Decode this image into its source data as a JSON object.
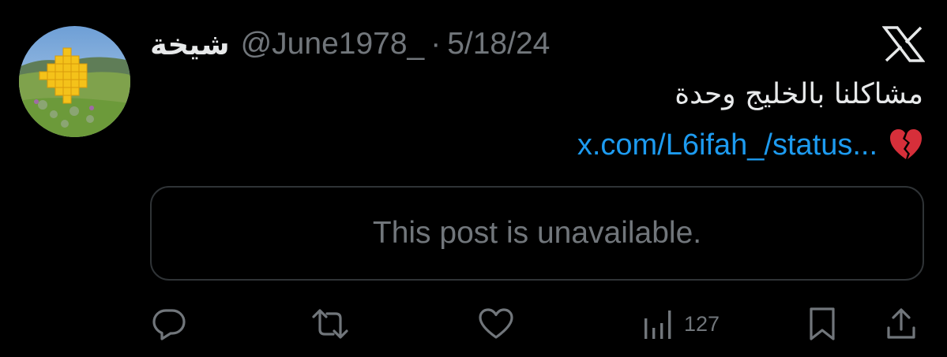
{
  "tweet": {
    "display_name": "شيخة",
    "handle": "@June1978_",
    "separator": "·",
    "date": "5/18/24",
    "text": "مشاكلنا بالخليج وحدة",
    "link_text": "x.com/L6ifah_/status...",
    "emoji": "broken-heart",
    "quoted_unavailable_text": "This post is unavailable.",
    "views_count": "127"
  },
  "icons": {
    "brand": "x-logo-icon",
    "reply": "reply-icon",
    "retweet": "retweet-icon",
    "like": "like-icon",
    "views": "views-icon",
    "bookmark": "bookmark-icon",
    "share": "share-icon"
  },
  "colors": {
    "background": "#000000",
    "primary_text": "#e7e9ea",
    "secondary_text": "#71767b",
    "link": "#1d9bf0",
    "border": "#2f3336",
    "emoji_heart": "#d62f3a"
  }
}
